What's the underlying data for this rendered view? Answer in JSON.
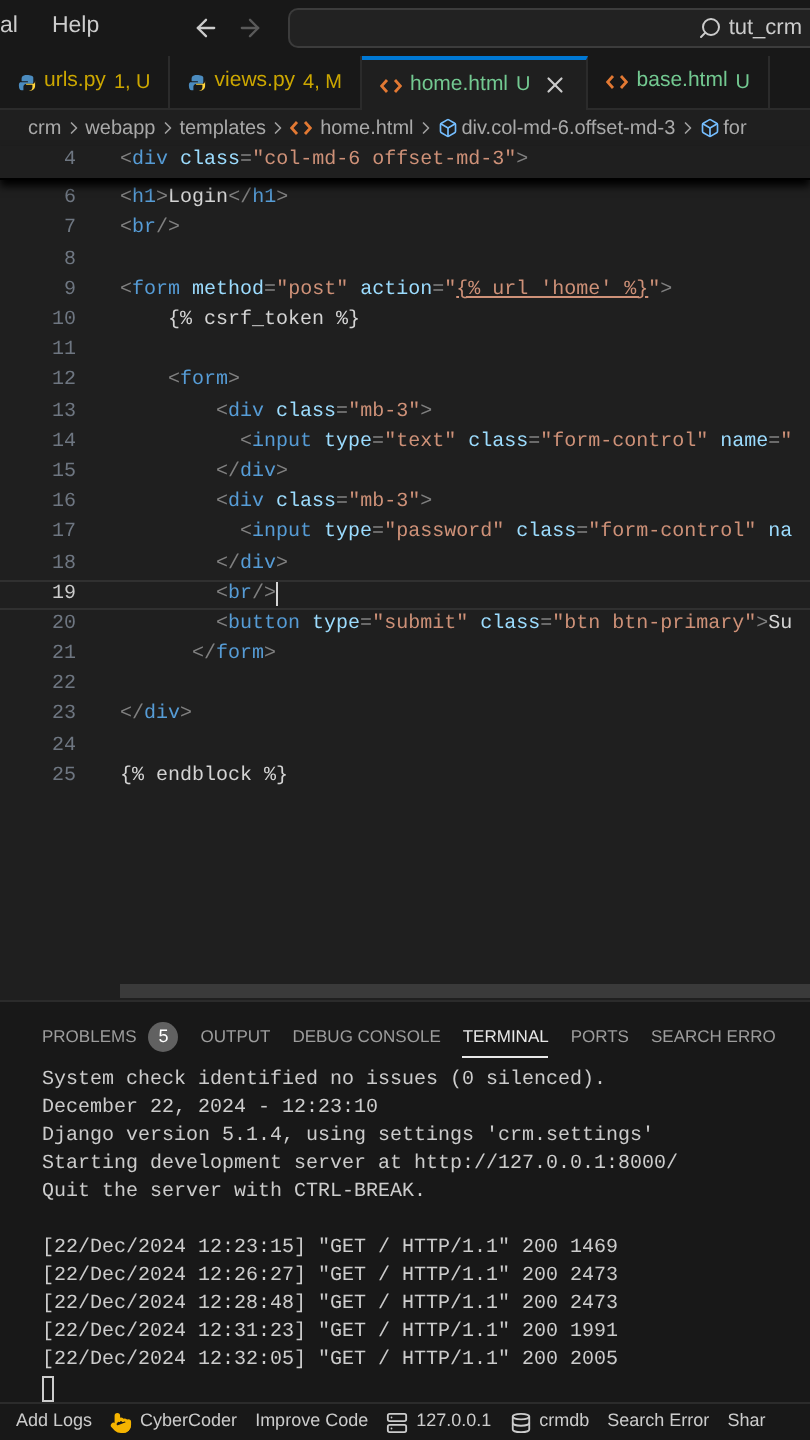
{
  "menu": [
    {
      "label": "al"
    },
    {
      "label": "Help"
    }
  ],
  "nav_buttons": [
    {
      "kind": "back",
      "disabled": false
    },
    {
      "kind": "forward",
      "disabled": true
    }
  ],
  "search": {
    "value": "tut_crm"
  },
  "tabs": [
    {
      "name": "urls.py",
      "badge": "1, U",
      "kind": "python",
      "color": "#cca700",
      "selected": false
    },
    {
      "name": "views.py",
      "badge": "4, M",
      "kind": "python",
      "color": "#cca700",
      "selected": false
    },
    {
      "name": "home.html",
      "badge": "U",
      "kind": "html",
      "color": "#73c991",
      "selected": true
    },
    {
      "name": "base.html",
      "badge": "U",
      "kind": "html",
      "color": "#73c991",
      "selected": false
    }
  ],
  "breadcrumb": [
    {
      "label": "crm",
      "kind": "folder"
    },
    {
      "label": "webapp",
      "kind": "folder"
    },
    {
      "label": "templates",
      "kind": "folder"
    },
    {
      "label": "home.html",
      "kind": "html"
    },
    {
      "label": "div.col-md-6.offset-md-3",
      "kind": "element"
    },
    {
      "label": "for",
      "kind": "element"
    }
  ],
  "editor": {
    "sticky": {
      "number": "4",
      "tokens": [
        {
          "kind": "p",
          "text": "<"
        },
        {
          "kind": "tag",
          "text": "div"
        },
        {
          "kind": "attr",
          "text": " class"
        },
        {
          "kind": "p",
          "text": "="
        },
        {
          "kind": "str",
          "text": "\"col-md-6 offset-md-3\""
        },
        {
          "kind": "p",
          "text": ">"
        }
      ]
    },
    "lines": [
      {
        "number": "6",
        "current": false,
        "tokens": [
          {
            "kind": "p",
            "text": "<"
          },
          {
            "kind": "tag",
            "text": "h1"
          },
          {
            "kind": "p",
            "text": ">"
          },
          {
            "kind": "txt",
            "text": "Login"
          },
          {
            "kind": "p",
            "text": "</"
          },
          {
            "kind": "tag",
            "text": "h1"
          },
          {
            "kind": "p",
            "text": ">"
          }
        ]
      },
      {
        "number": "7",
        "current": false,
        "tokens": [
          {
            "kind": "p",
            "text": "<"
          },
          {
            "kind": "tag",
            "text": "br"
          },
          {
            "kind": "p",
            "text": "/>"
          }
        ]
      },
      {
        "number": "8",
        "current": false
      },
      {
        "number": "9",
        "current": false,
        "tokens": [
          {
            "kind": "p",
            "text": "<"
          },
          {
            "kind": "tag",
            "text": "form"
          },
          {
            "kind": "attr",
            "text": " method"
          },
          {
            "kind": "p",
            "text": "="
          },
          {
            "kind": "str",
            "text": "\"post\""
          },
          {
            "kind": "attr",
            "text": " action"
          },
          {
            "kind": "p",
            "text": "="
          },
          {
            "kind": "str",
            "text": "\""
          },
          {
            "kind": "link",
            "text": "{% url 'home' %}"
          },
          {
            "kind": "str",
            "text": "\""
          },
          {
            "kind": "p",
            "text": ">"
          }
        ]
      },
      {
        "number": "10",
        "current": false,
        "tokens": [
          {
            "kind": "txt",
            "text": "    {% csrf_token %}"
          }
        ]
      },
      {
        "number": "11",
        "current": false
      },
      {
        "number": "12",
        "current": false,
        "tokens": [
          {
            "kind": "p",
            "text": "    <"
          },
          {
            "kind": "tag",
            "text": "form"
          },
          {
            "kind": "p",
            "text": ">"
          }
        ]
      },
      {
        "number": "13",
        "current": false,
        "tokens": [
          {
            "kind": "p",
            "text": "        <"
          },
          {
            "kind": "tag",
            "text": "div"
          },
          {
            "kind": "attr",
            "text": " class"
          },
          {
            "kind": "p",
            "text": "="
          },
          {
            "kind": "str",
            "text": "\"mb-3\""
          },
          {
            "kind": "p",
            "text": ">"
          }
        ]
      },
      {
        "number": "14",
        "current": false,
        "tokens": [
          {
            "kind": "p",
            "text": "          <"
          },
          {
            "kind": "tag",
            "text": "input"
          },
          {
            "kind": "attr",
            "text": " type"
          },
          {
            "kind": "p",
            "text": "="
          },
          {
            "kind": "str",
            "text": "\"text\""
          },
          {
            "kind": "attr",
            "text": " class"
          },
          {
            "kind": "p",
            "text": "="
          },
          {
            "kind": "str",
            "text": "\"form-control\""
          },
          {
            "kind": "attr",
            "text": " name"
          },
          {
            "kind": "p",
            "text": "="
          },
          {
            "kind": "str",
            "text": "\""
          }
        ]
      },
      {
        "number": "15",
        "current": false,
        "tokens": [
          {
            "kind": "p",
            "text": "        </"
          },
          {
            "kind": "tag",
            "text": "div"
          },
          {
            "kind": "p",
            "text": ">"
          }
        ]
      },
      {
        "number": "16",
        "current": false,
        "tokens": [
          {
            "kind": "p",
            "text": "        <"
          },
          {
            "kind": "tag",
            "text": "div"
          },
          {
            "kind": "attr",
            "text": " class"
          },
          {
            "kind": "p",
            "text": "="
          },
          {
            "kind": "str",
            "text": "\"mb-3\""
          },
          {
            "kind": "p",
            "text": ">"
          }
        ]
      },
      {
        "number": "17",
        "current": false,
        "tokens": [
          {
            "kind": "p",
            "text": "          <"
          },
          {
            "kind": "tag",
            "text": "input"
          },
          {
            "kind": "attr",
            "text": " type"
          },
          {
            "kind": "p",
            "text": "="
          },
          {
            "kind": "str",
            "text": "\"password\""
          },
          {
            "kind": "attr",
            "text": " class"
          },
          {
            "kind": "p",
            "text": "="
          },
          {
            "kind": "str",
            "text": "\"form-control\""
          },
          {
            "kind": "attr",
            "text": " na"
          }
        ]
      },
      {
        "number": "18",
        "current": false,
        "tokens": [
          {
            "kind": "p",
            "text": "        </"
          },
          {
            "kind": "tag",
            "text": "div"
          },
          {
            "kind": "p",
            "text": ">"
          }
        ]
      },
      {
        "number": "19",
        "current": true,
        "tokens": [
          {
            "kind": "p",
            "text": "        <"
          },
          {
            "kind": "tag",
            "text": "br"
          },
          {
            "kind": "p",
            "text": "/>"
          }
        ]
      },
      {
        "number": "20",
        "current": false,
        "tokens": [
          {
            "kind": "p",
            "text": "        <"
          },
          {
            "kind": "tag",
            "text": "button"
          },
          {
            "kind": "attr",
            "text": " type"
          },
          {
            "kind": "p",
            "text": "="
          },
          {
            "kind": "str",
            "text": "\"submit\""
          },
          {
            "kind": "attr",
            "text": " class"
          },
          {
            "kind": "p",
            "text": "="
          },
          {
            "kind": "str",
            "text": "\"btn btn-primary\""
          },
          {
            "kind": "p",
            "text": ">"
          },
          {
            "kind": "txt",
            "text": "Su"
          }
        ]
      },
      {
        "number": "21",
        "current": false,
        "tokens": [
          {
            "kind": "p",
            "text": "      </"
          },
          {
            "kind": "tag",
            "text": "form"
          },
          {
            "kind": "p",
            "text": ">"
          }
        ]
      },
      {
        "number": "22",
        "current": false
      },
      {
        "number": "23",
        "current": false,
        "tokens": [
          {
            "kind": "p",
            "text": "</"
          },
          {
            "kind": "tag",
            "text": "div"
          },
          {
            "kind": "p",
            "text": ">"
          }
        ]
      },
      {
        "number": "24",
        "current": false
      },
      {
        "number": "25",
        "current": false,
        "tokens": [
          {
            "kind": "txt",
            "text": "{% endblock %}"
          }
        ]
      }
    ]
  },
  "panel_tabs": [
    {
      "label": "PROBLEMS",
      "badge": "5",
      "selected": false
    },
    {
      "label": "OUTPUT",
      "selected": false
    },
    {
      "label": "DEBUG CONSOLE",
      "selected": false
    },
    {
      "label": "TERMINAL",
      "selected": true
    },
    {
      "label": "PORTS",
      "selected": false
    },
    {
      "label": "SEARCH ERRO",
      "selected": false
    }
  ],
  "terminal": {
    "blocks": [
      [
        "System check identified no issues (0 silenced).",
        "December 22, 2024 - 12:23:10",
        "Django version 5.1.4, using settings 'crm.settings'",
        "Starting development server at http://127.0.0.1:8000/",
        "Quit the server with CTRL-BREAK."
      ],
      [
        "[22/Dec/2024 12:23:15] \"GET / HTTP/1.1\" 200 1469",
        "[22/Dec/2024 12:26:27] \"GET / HTTP/1.1\" 200 2473",
        "[22/Dec/2024 12:28:48] \"GET / HTTP/1.1\" 200 2473",
        "[22/Dec/2024 12:31:23] \"GET / HTTP/1.1\" 200 1991",
        "[22/Dec/2024 12:32:05] \"GET / HTTP/1.1\" 200 2005"
      ]
    ]
  },
  "status_bar": [
    {
      "label": "Add Logs",
      "kind": "text"
    },
    {
      "label": "CyberCoder",
      "kind": "hand"
    },
    {
      "label": "Improve Code",
      "kind": "text"
    },
    {
      "label": "127.0.0.1",
      "kind": "server"
    },
    {
      "label": "crmdb",
      "kind": "database"
    },
    {
      "label": "Search Error",
      "kind": "text"
    },
    {
      "label": "Shar",
      "kind": "text"
    }
  ]
}
